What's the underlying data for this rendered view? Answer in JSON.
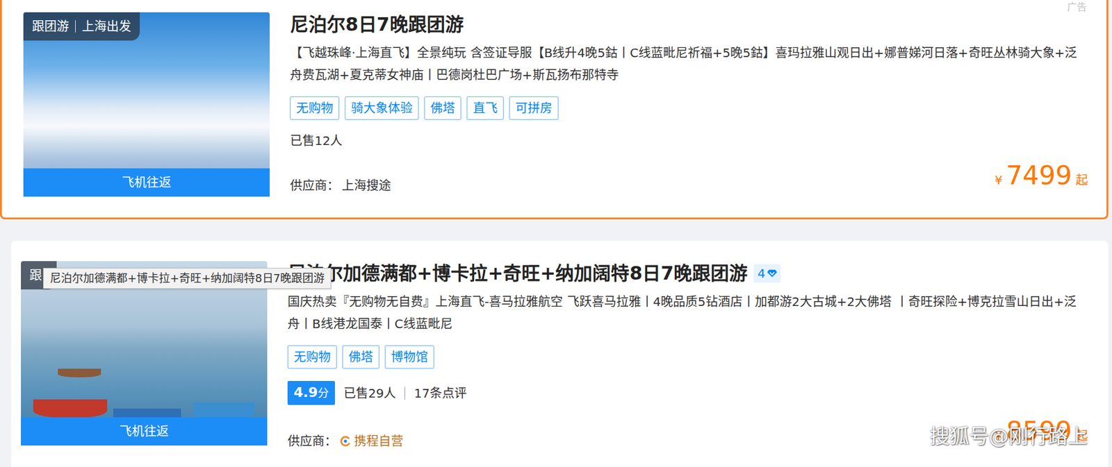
{
  "ad_label": "广告",
  "products": [
    {
      "highlighted": true,
      "image": {
        "kind": "mountain",
        "label_left": "跟团游",
        "label_right": "上海出发",
        "bottom": "飞机往返"
      },
      "title": "尼泊尔8日7晚跟团游",
      "description": "【飞越珠峰·上海直飞】全景纯玩 含签证导服【B线升4晚5鈷丨C线蓝毗尼祈福+5晚5鈷】喜玛拉雅山观日出+娜普娣河日落+奇旺丛林骑大象+泛舟费瓦湖+夏克蒂女神庙丨巴德岗杜巴广场+斯瓦扬布那特寺",
      "tags": [
        "无购物",
        "骑大象体验",
        "佛塔",
        "直飞",
        "可拼房"
      ],
      "sold": "已售12人",
      "supplier_label": "供应商：",
      "supplier": "上海搜途",
      "official": false,
      "price_symbol": "¥",
      "price": "7499",
      "price_suffix": "起"
    },
    {
      "highlighted": false,
      "image": {
        "kind": "lake",
        "label_left": "跟",
        "label_right": "",
        "bottom": "飞机往返"
      },
      "title": "尼泊尔加德满都+博卡拉+奇旺+纳加阔特8日7晚跟团游",
      "level_badge": "4",
      "description": "国庆热卖『无购物无自费』上海直飞-喜马拉雅航空 飞跃喜马拉雅丨4晚品质5钻酒店丨加都游2大古城+2大佛塔 丨奇旺探险+博克拉雪山日出+泛舟丨B线港龙国泰丨C线蓝毗尼",
      "tags": [
        "无购物",
        "佛塔",
        "博物馆"
      ],
      "rating": "4.9",
      "rating_unit": "分",
      "sold": "已售29人",
      "reviews": "17条点评",
      "supplier_label": "供应商：",
      "supplier": "携程自营",
      "official": true,
      "price_symbol": "¥",
      "price": "8599",
      "price_suffix": "起"
    }
  ],
  "tooltip": "尼泊尔加德满都+博卡拉+奇旺+纳加阔特8日7晚跟团游",
  "watermark": "搜狐号@刚行路上"
}
